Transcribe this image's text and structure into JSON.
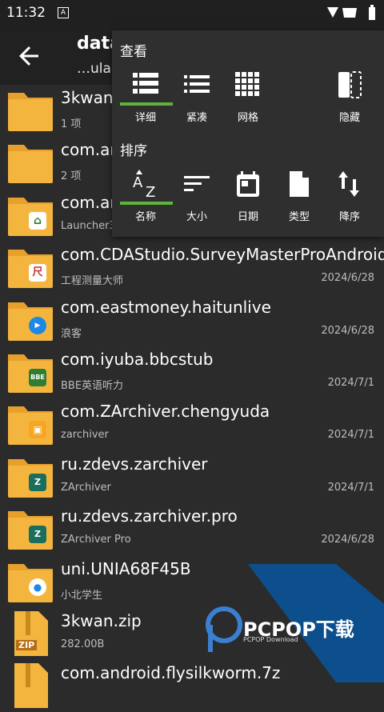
{
  "status": {
    "time": "11:32",
    "notif": "A"
  },
  "toolbar": {
    "title": "data",
    "subtitle": "…ula"
  },
  "menu": {
    "view_title": "查看",
    "view_options": [
      {
        "label": "详细",
        "icon": "list-detail-icon",
        "selected": true
      },
      {
        "label": "紧凑",
        "icon": "list-compact-icon",
        "selected": false
      },
      {
        "label": "网格",
        "icon": "grid-icon",
        "selected": false
      },
      {
        "label": "隐藏",
        "icon": "hide-icon",
        "selected": false
      }
    ],
    "sort_title": "排序",
    "sort_options": [
      {
        "label": "名称",
        "icon": "sort-az-icon",
        "selected": true
      },
      {
        "label": "大小",
        "icon": "sort-size-icon",
        "selected": false
      },
      {
        "label": "日期",
        "icon": "calendar-icon",
        "selected": false
      },
      {
        "label": "类型",
        "icon": "file-type-icon",
        "selected": false
      },
      {
        "label": "降序",
        "icon": "sort-desc-icon",
        "selected": false
      }
    ]
  },
  "files": [
    {
      "name": "3kwan",
      "sub": "1 项",
      "date": "",
      "kind": "folder",
      "badge": ""
    },
    {
      "name": "com.an",
      "sub": "2 项",
      "date": "",
      "kind": "folder",
      "badge": ""
    },
    {
      "name": "com.an",
      "sub": "Launcher3",
      "date": "",
      "kind": "folder",
      "badge": "home"
    },
    {
      "name": "com.CDAStudio.SurveyMasterProAndroid",
      "sub": "工程测量大师",
      "date": "2024/6/28",
      "kind": "folder",
      "badge": "尺"
    },
    {
      "name": "com.eastmoney.haitunlive",
      "sub": "浪客",
      "date": "2024/6/28",
      "kind": "folder",
      "badge": "play"
    },
    {
      "name": "com.iyuba.bbcstub",
      "sub": "BBE英语听力",
      "date": "2024/7/1",
      "kind": "folder",
      "badge": "BBE"
    },
    {
      "name": "com.ZArchiver.chengyuda",
      "sub": "zarchiver",
      "date": "2024/7/1",
      "kind": "folder",
      "badge": "img"
    },
    {
      "name": "ru.zdevs.zarchiver",
      "sub": "ZArchiver",
      "date": "2024/7/1",
      "kind": "folder",
      "badge": "ZA"
    },
    {
      "name": "ru.zdevs.zarchiver.pro",
      "sub": "ZArchiver Pro",
      "date": "2024/6/28",
      "kind": "folder",
      "badge": "ZA"
    },
    {
      "name": "uni.UNIA68F45B",
      "sub": "小北学生",
      "date": "",
      "kind": "folder",
      "badge": "person"
    },
    {
      "name": "3kwan.zip",
      "sub": "282.00B",
      "date": "",
      "kind": "zip",
      "badge": "ZIP"
    },
    {
      "name": "com.android.flysilkworm.7z",
      "sub": "",
      "date": "",
      "kind": "zip",
      "badge": ""
    }
  ],
  "watermark": {
    "text": "PCPOP下载",
    "small": "PCPOP Download"
  },
  "colors": {
    "folder": "#f4b53f",
    "folder_tab": "#e8a02c",
    "accent": "#5fb33a",
    "menu_bg": "#2f2f2f"
  }
}
